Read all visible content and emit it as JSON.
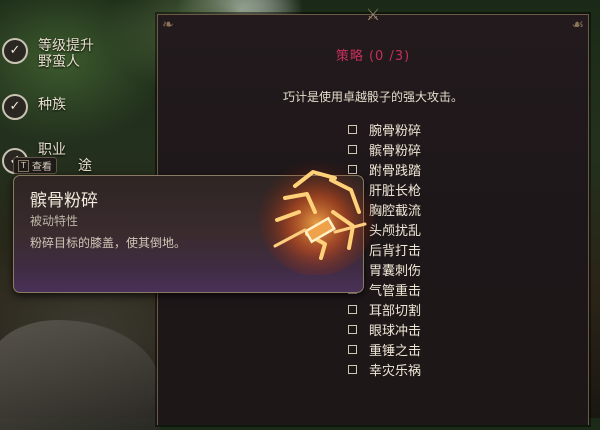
{
  "steps": [
    {
      "line1": "等级提升",
      "line2": "野蛮人"
    },
    {
      "line1": "种族",
      "line2": ""
    },
    {
      "line1": "职业",
      "line2": ""
    },
    {
      "line1": "背景/出身途径",
      "line2": ""
    }
  ],
  "steps_visible_labels": [
    "等级提升",
    "野蛮人",
    "种族",
    "职业",
    "途"
  ],
  "panel": {
    "title": "策略  (0 /3)",
    "description": "巧计是使用卓越骰子的强大攻击。",
    "options": [
      "腕骨粉碎",
      "髌骨粉碎",
      "跗骨践踏",
      "肝脏长枪",
      "胸腔截流",
      "头颅扰乱",
      "后背打击",
      "胃囊刺伤",
      "气管重击",
      "耳部切割",
      "眼球冲击",
      "重锤之击",
      "幸灾乐祸"
    ]
  },
  "tooltip": {
    "key": "T",
    "key_action": "查看",
    "name": "髌骨粉碎",
    "subtitle": "被动特性",
    "description": "粉碎目标的膝盖，使其倒地。"
  },
  "colors": {
    "title_accent": "#c62f5b",
    "panel_border": "#6d5a44",
    "tooltip_gradient_end": "#4a3158"
  },
  "icons": [
    "check-icon",
    "kneecap-shatter-icon",
    "ornament-icon"
  ]
}
